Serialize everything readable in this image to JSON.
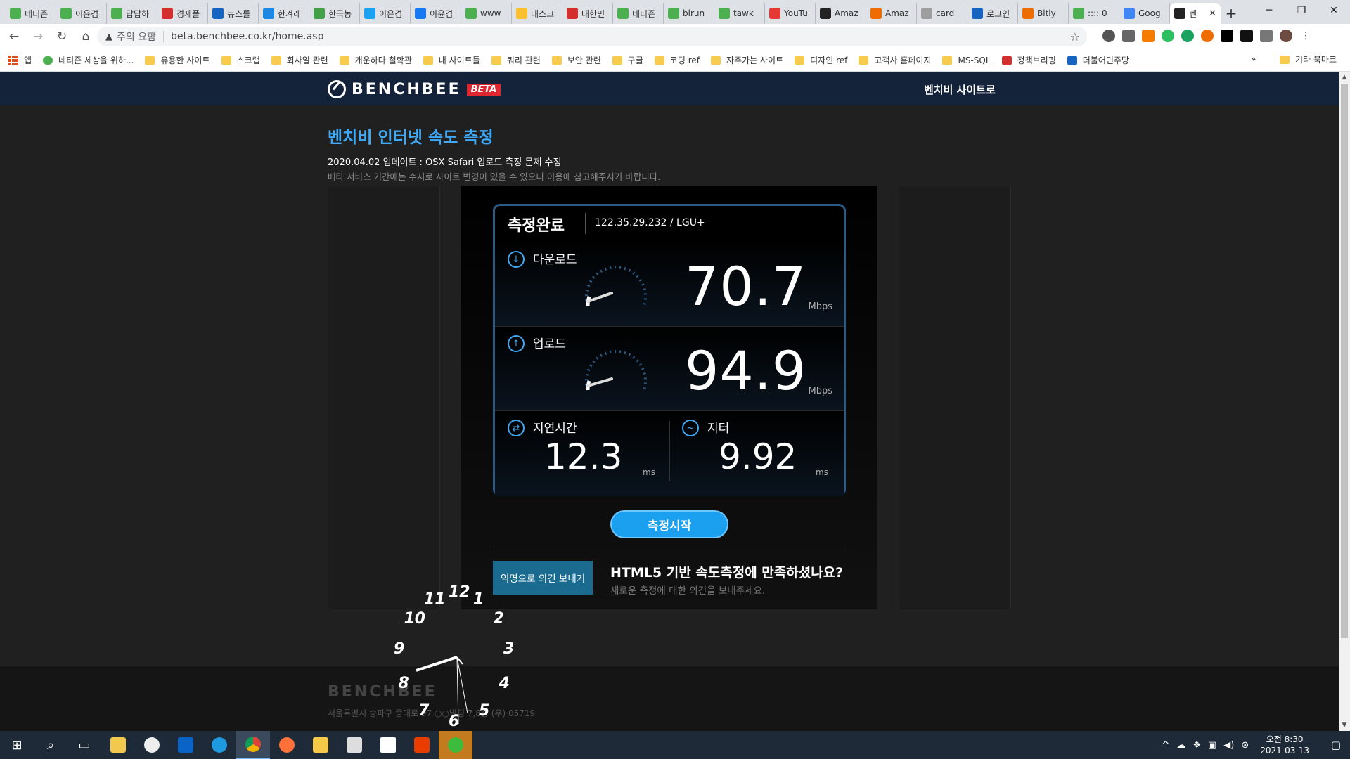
{
  "browser": {
    "tabs": [
      {
        "label": "네티즌",
        "color": "#4caf50"
      },
      {
        "label": "이윤겸",
        "color": "#4caf50"
      },
      {
        "label": "답답하",
        "color": "#4caf50"
      },
      {
        "label": "경제플",
        "color": "#d32f2f"
      },
      {
        "label": "뉴스를",
        "color": "#1565c0"
      },
      {
        "label": "한겨레",
        "color": "#1e88e5"
      },
      {
        "label": "한국농",
        "color": "#43a047"
      },
      {
        "label": "이윤겸",
        "color": "#1da1f2"
      },
      {
        "label": "이윤겸",
        "color": "#1877f2"
      },
      {
        "label": "www",
        "color": "#4caf50"
      },
      {
        "label": "내스크",
        "color": "#fbc02d"
      },
      {
        "label": "대한민",
        "color": "#d32f2f"
      },
      {
        "label": "네티즌",
        "color": "#4caf50"
      },
      {
        "label": "blrun",
        "color": "#4caf50"
      },
      {
        "label": "tawk",
        "color": "#4caf50"
      },
      {
        "label": "YouTu",
        "color": "#e53935"
      },
      {
        "label": "Amaz",
        "color": "#222222"
      },
      {
        "label": "Amaz",
        "color": "#ef6c00"
      },
      {
        "label": "card",
        "color": "#9e9e9e"
      },
      {
        "label": "로그인",
        "color": "#1565c0"
      },
      {
        "label": "Bitly",
        "color": "#ef6c00"
      },
      {
        "label": ":::: 0",
        "color": "#4caf50"
      },
      {
        "label": "Goog",
        "color": "#4285f4"
      }
    ],
    "active_tab": {
      "label": "벤",
      "close": "✕"
    },
    "new_tab": "+",
    "window_controls": {
      "minimize": "─",
      "restore": "❐",
      "close": "✕"
    },
    "nav": {
      "back": "←",
      "forward": "→",
      "reload": "↻",
      "home": "⌂"
    },
    "omnibox": {
      "security": "주의 요함",
      "url": "beta.benchbee.co.kr/home.asp",
      "warn_icon": "▲",
      "star": "☆"
    },
    "bookmarks": [
      {
        "label": "앱",
        "type": "apps"
      },
      {
        "label": "네티즌 세상을 위하...",
        "type": "g"
      },
      {
        "label": "유용한 사이트",
        "type": "f"
      },
      {
        "label": "스크랩",
        "type": "f"
      },
      {
        "label": "회사일 관련",
        "type": "f"
      },
      {
        "label": "개운하다 철학관",
        "type": "f"
      },
      {
        "label": "내 사이트들",
        "type": "f"
      },
      {
        "label": "쿼리 관련",
        "type": "f"
      },
      {
        "label": "보안 관련",
        "type": "f"
      },
      {
        "label": "구글",
        "type": "f"
      },
      {
        "label": "코딩 ref",
        "type": "f"
      },
      {
        "label": "자주가는 사이트",
        "type": "f"
      },
      {
        "label": "디자인 ref",
        "type": "f"
      },
      {
        "label": "고객사 홈페이지",
        "type": "f"
      },
      {
        "label": "MS-SQL",
        "type": "f"
      },
      {
        "label": "정책브리핑",
        "type": "r"
      },
      {
        "label": "더불어민주당",
        "type": "b"
      }
    ],
    "bookmarks_more": "»",
    "other_bookmarks": "기타 북마크"
  },
  "site": {
    "logo_word": "BENCHBEE",
    "logo_badge": "BETA",
    "site_link": "벤치비 사이트로",
    "headline": "벤치비 인터넷 속도 측정",
    "update_note": "2020.04.02 업데이트 : OSX Safari 업로드 측정 문제 수정",
    "beta_notice": "베타 서비스 기간에는 수시로 사이트 변경이 있을 수 있으니 이용에 참고해주시기 바랍니다.",
    "result": {
      "status": "측정완료",
      "ip_isp": "122.35.29.232 / LGU+",
      "download": {
        "label": "다운로드",
        "value": "70.7",
        "unit": "Mbps",
        "icon": "download-icon"
      },
      "upload": {
        "label": "업로드",
        "value": "94.9",
        "unit": "Mbps",
        "icon": "upload-icon"
      },
      "latency": {
        "label": "지연시간",
        "value": "12.3",
        "unit": "ms",
        "icon": "latency-icon"
      },
      "jitter": {
        "label": "지터",
        "value": "9.92",
        "unit": "ms",
        "icon": "jitter-icon"
      }
    },
    "start_button": "측정시작",
    "feedback_button": "익명으로 의견 보내기",
    "feedback_title": "HTML5 기반 속도측정에 만족하셨나요?",
    "feedback_sub": "새로운 측정에 대한 의견을 보내주세요.",
    "footer_logo": "BENCHBEE",
    "footer_address": "서울특별시 송파구 중대로 97 ○○빌딩 7,8층 (우) 05719",
    "clock_numbers": [
      "12",
      "1",
      "2",
      "3",
      "4",
      "5",
      "6",
      "7",
      "8",
      "9",
      "10",
      "11"
    ]
  },
  "taskbar": {
    "tray_time": "오전 8:30",
    "tray_date": "2021-03-13",
    "tray_caret": "^"
  },
  "colors": {
    "accent": "#3fa9f5",
    "header_bg": "#14233a",
    "button": "#1aa0ef",
    "beta_badge": "#e0262e"
  }
}
